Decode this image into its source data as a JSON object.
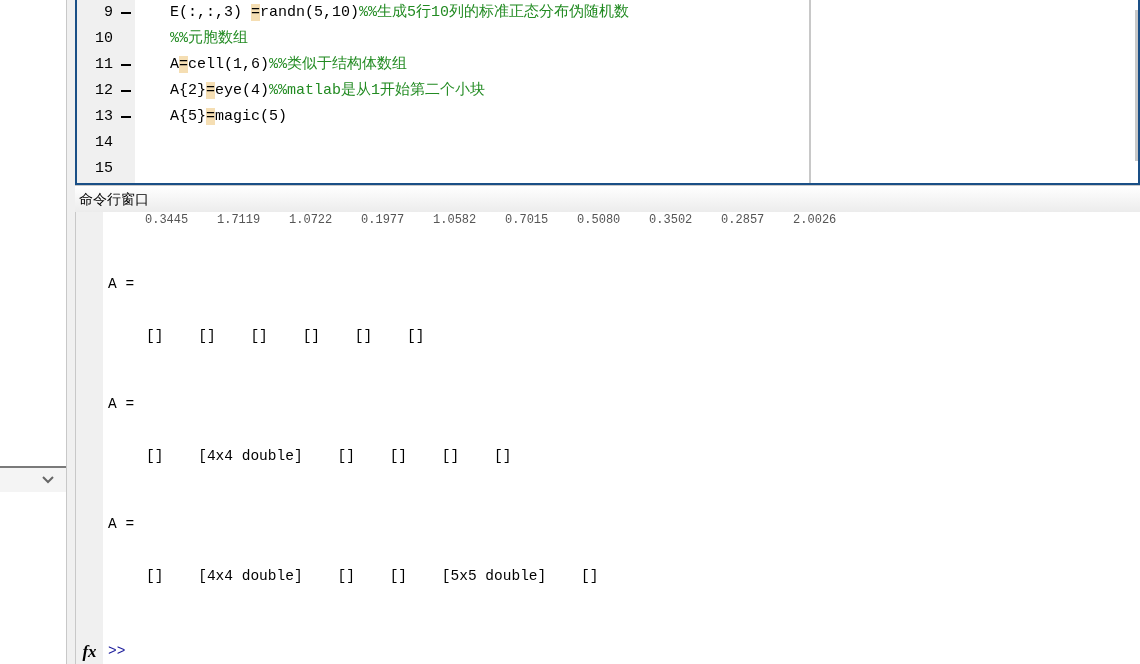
{
  "editor": {
    "lines": [
      {
        "number": "9",
        "breakpoint_dash": true,
        "segments": [
          {
            "kind": "code",
            "text": "E(:,:,3) "
          },
          {
            "kind": "marked",
            "text": "="
          },
          {
            "kind": "code",
            "text": "randn(5,10)"
          },
          {
            "kind": "comment",
            "text": "%%生成5行10列的标准正态分布伪随机数"
          }
        ]
      },
      {
        "number": "10",
        "breakpoint_dash": false,
        "segments": [
          {
            "kind": "comment",
            "text": "%%元胞数组"
          }
        ]
      },
      {
        "number": "11",
        "breakpoint_dash": true,
        "segments": [
          {
            "kind": "code",
            "text": "A"
          },
          {
            "kind": "marked",
            "text": "="
          },
          {
            "kind": "code",
            "text": "cell(1,6)"
          },
          {
            "kind": "comment",
            "text": "%%类似于结构体数组"
          }
        ]
      },
      {
        "number": "12",
        "breakpoint_dash": true,
        "segments": [
          {
            "kind": "code",
            "text": "A{2}"
          },
          {
            "kind": "marked",
            "text": "="
          },
          {
            "kind": "code",
            "text": "eye(4)"
          },
          {
            "kind": "comment",
            "text": "%%matlab是从1开始第二个小块"
          }
        ]
      },
      {
        "number": "13",
        "breakpoint_dash": true,
        "segments": [
          {
            "kind": "code",
            "text": "A{5}"
          },
          {
            "kind": "marked",
            "text": "="
          },
          {
            "kind": "code",
            "text": "magic(5)"
          }
        ]
      },
      {
        "number": "14",
        "breakpoint_dash": false
      },
      {
        "number": "15",
        "breakpoint_dash": false
      }
    ]
  },
  "command_window": {
    "title": "命令行窗口",
    "output": [
      {
        "kind": "partial",
        "text": "0.3445    1.7119    1.0722    0.1977    1.0582    0.7015    0.5080    0.3502    0.2857    2.0026"
      },
      {
        "kind": "label",
        "text": "A ="
      },
      {
        "kind": "cells",
        "text": "[]    []    []    []    []    []"
      },
      {
        "kind": "label",
        "text": "A ="
      },
      {
        "kind": "cells",
        "text": "[]    [4x4 double]    []    []    []    []"
      },
      {
        "kind": "label",
        "text": "A ="
      },
      {
        "kind": "cells",
        "text": "[]    [4x4 double]    []    []    [5x5 double]    []"
      }
    ],
    "function_button": "fx",
    "prompt": ">>"
  }
}
